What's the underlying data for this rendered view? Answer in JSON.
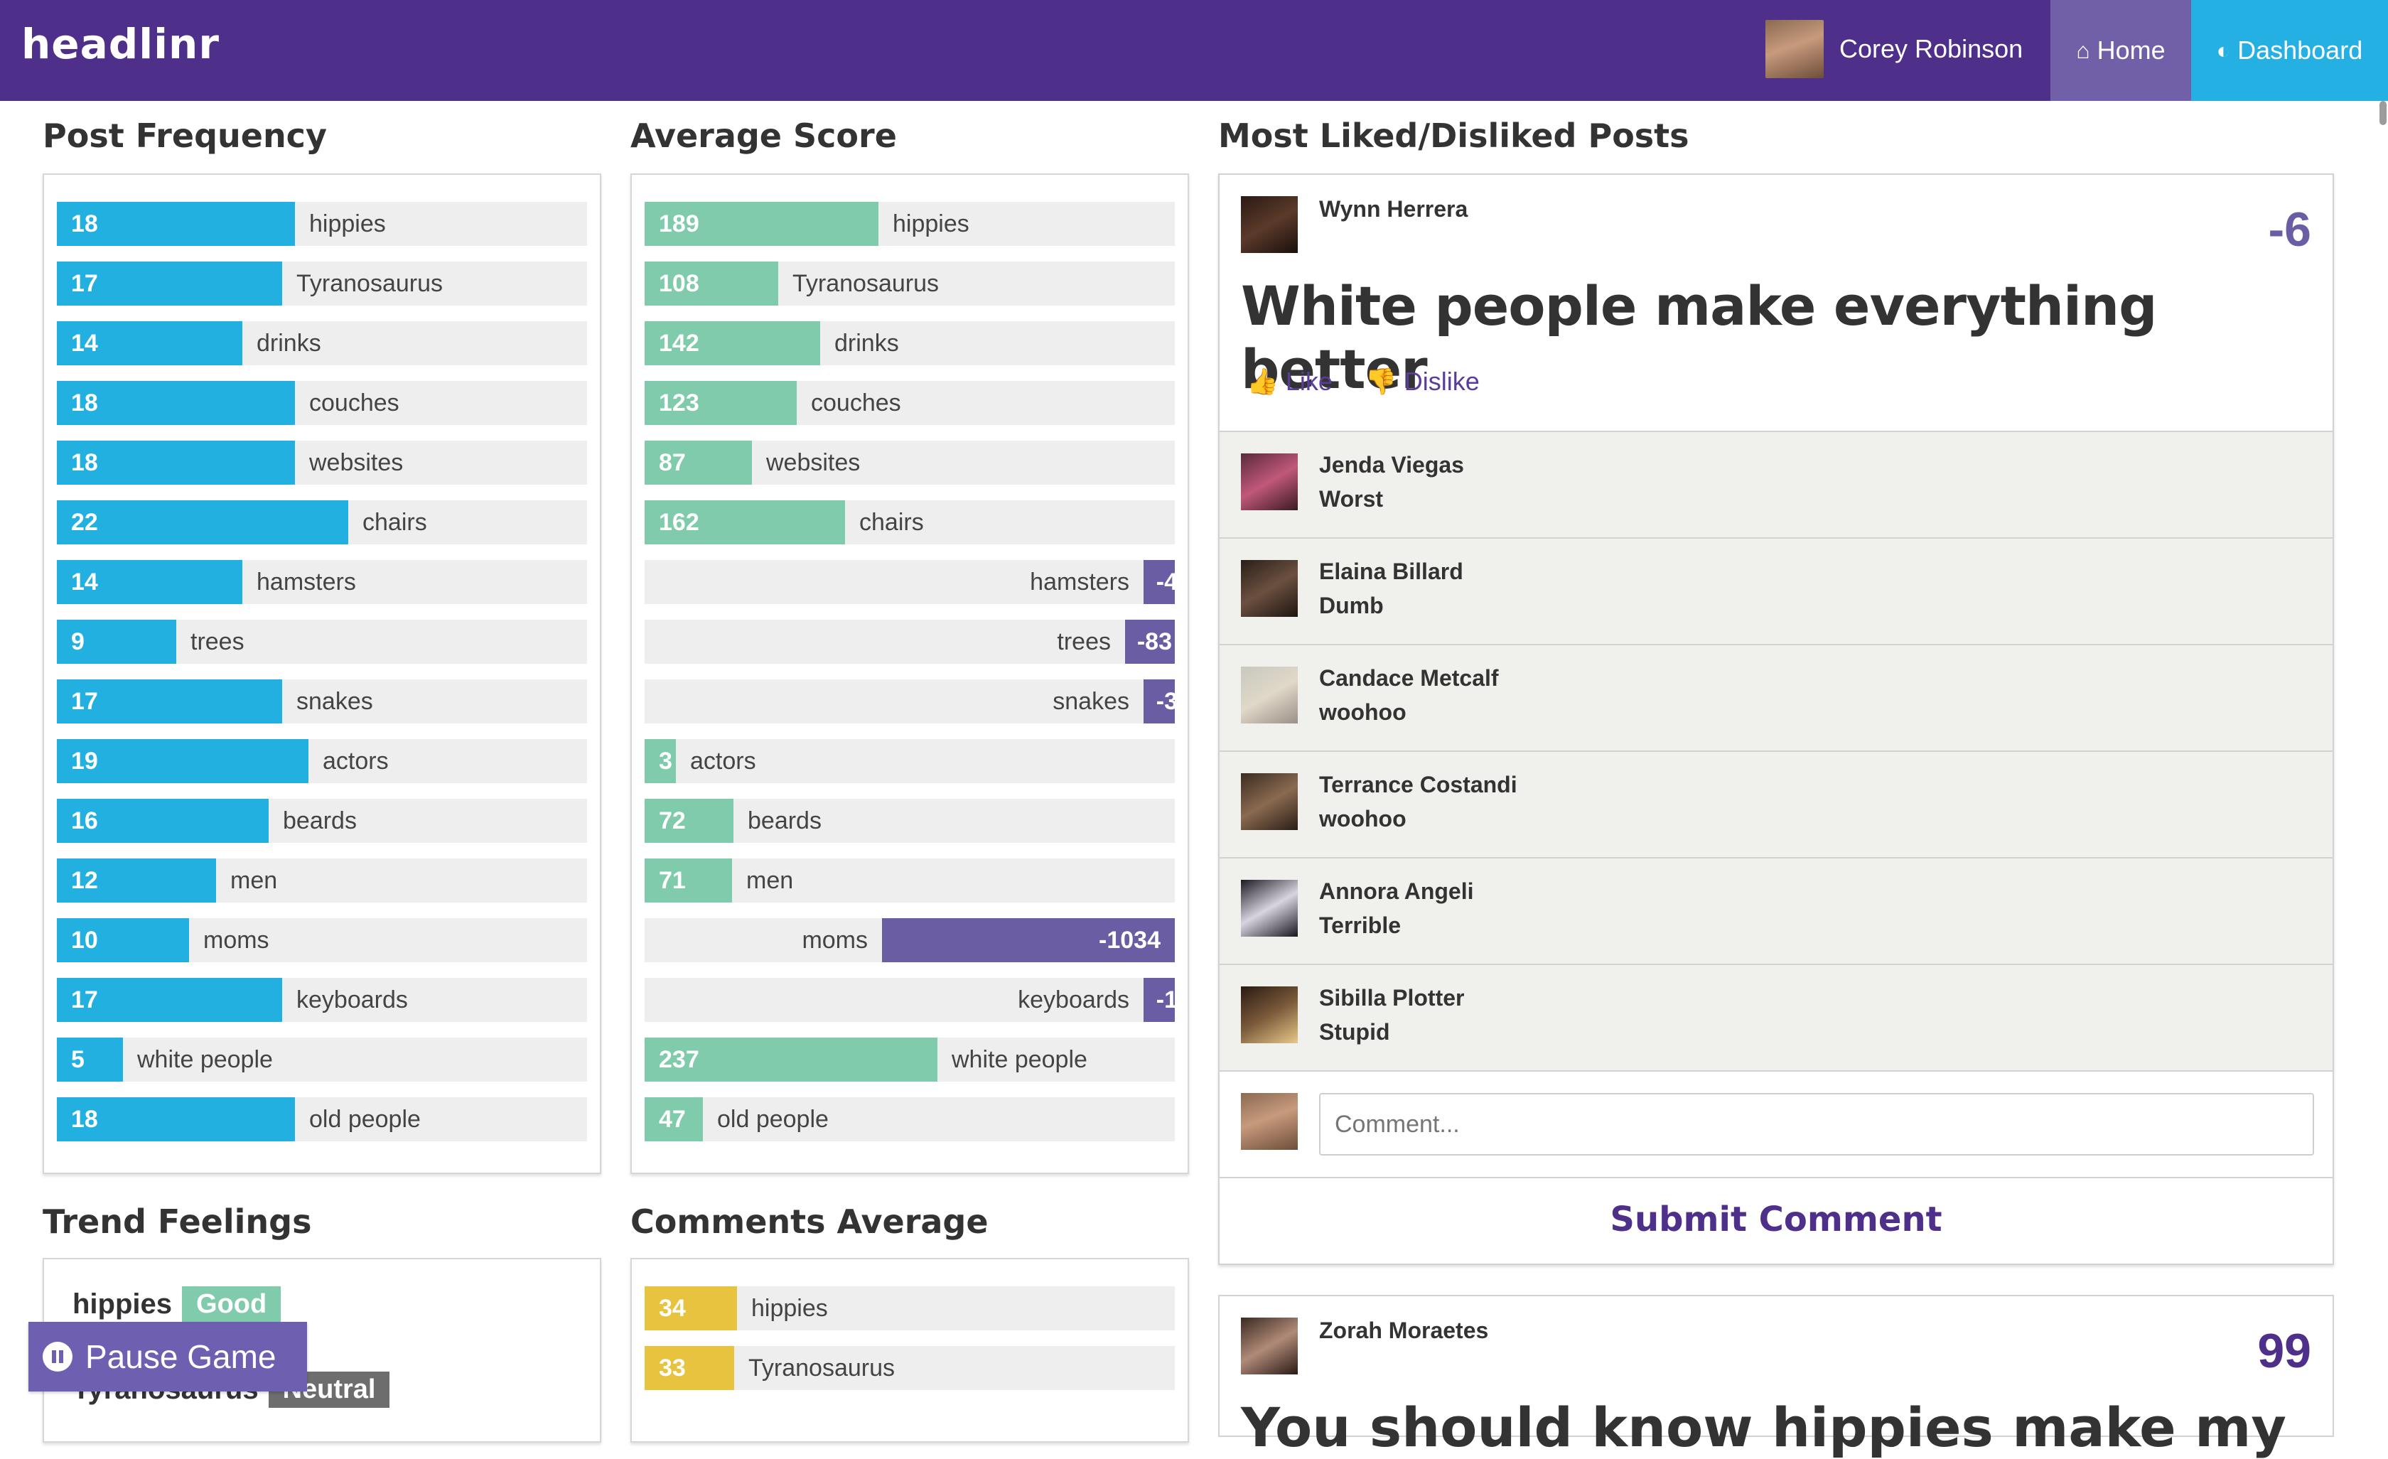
{
  "navbar": {
    "brand": "headlinr",
    "user_name": "Corey Robinson",
    "home_label": "Home",
    "dashboard_label": "Dashboard"
  },
  "sections": {
    "post_frequency": "Post Frequency",
    "average_score": "Average Score",
    "most_liked": "Most Liked/Disliked Posts",
    "trend_feelings": "Trend Feelings",
    "comments_average": "Comments Average"
  },
  "post_frequency": [
    {
      "label": "hippies",
      "value": 18
    },
    {
      "label": "Tyranosaurus",
      "value": 17
    },
    {
      "label": "drinks",
      "value": 14
    },
    {
      "label": "couches",
      "value": 18
    },
    {
      "label": "websites",
      "value": 18
    },
    {
      "label": "chairs",
      "value": 22
    },
    {
      "label": "hamsters",
      "value": 14
    },
    {
      "label": "trees",
      "value": 9
    },
    {
      "label": "snakes",
      "value": 17
    },
    {
      "label": "actors",
      "value": 19
    },
    {
      "label": "beards",
      "value": 16
    },
    {
      "label": "men",
      "value": 12
    },
    {
      "label": "moms",
      "value": 10
    },
    {
      "label": "keyboards",
      "value": 17
    },
    {
      "label": "white people",
      "value": 5
    },
    {
      "label": "old people",
      "value": 18
    }
  ],
  "average_score": [
    {
      "label": "hippies",
      "value": "189"
    },
    {
      "label": "Tyranosaurus",
      "value": "108"
    },
    {
      "label": "drinks",
      "value": "142"
    },
    {
      "label": "couches",
      "value": "123"
    },
    {
      "label": "websites",
      "value": "87"
    },
    {
      "label": "chairs",
      "value": "162"
    },
    {
      "label": "hamsters",
      "value": "-4"
    },
    {
      "label": "trees",
      "value": "-83"
    },
    {
      "label": "snakes",
      "value": "-3"
    },
    {
      "label": "actors",
      "value": "3"
    },
    {
      "label": "beards",
      "value": "72"
    },
    {
      "label": "men",
      "value": "71"
    },
    {
      "label": "moms",
      "value": "-1034"
    },
    {
      "label": "keyboards",
      "value": "-1"
    },
    {
      "label": "white people",
      "value": "237"
    },
    {
      "label": "old people",
      "value": "47"
    }
  ],
  "trend_feelings": [
    {
      "label": "hippies",
      "feeling": "Good",
      "color": "#7fcbac"
    },
    {
      "label": "Tyranosaurus",
      "feeling": "Neutral",
      "color": "#6d6d6d"
    }
  ],
  "comments_average": [
    {
      "label": "hippies",
      "value": 34
    },
    {
      "label": "Tyranosaurus",
      "value": 33
    }
  ],
  "pause_label": "Pause Game",
  "post": {
    "author": "Wynn Herrera",
    "score": "-6",
    "title": "White people make everything better",
    "like_label": "Like",
    "dislike_label": "Dislike",
    "comments": [
      {
        "name": "Jenda Viegas",
        "text": "Worst"
      },
      {
        "name": "Elaina Billard",
        "text": "Dumb"
      },
      {
        "name": "Candace Metcalf",
        "text": "woohoo"
      },
      {
        "name": "Terrance Costandi",
        "text": "woohoo"
      },
      {
        "name": "Annora Angeli",
        "text": "Terrible"
      },
      {
        "name": "Sibilla Plotter",
        "text": "Stupid"
      }
    ],
    "comment_placeholder": "Comment...",
    "submit_label": "Submit Comment"
  },
  "post2": {
    "author": "Zorah Moraetes",
    "score": "99",
    "title": "You should know hippies make my"
  },
  "colors": {
    "nav_bg": "#4e2f8a",
    "frequency_bar": "#22b0e1",
    "score_positive": "#7fcbac",
    "score_negative": "#6a5da4",
    "comments_bar": "#e8c33f"
  }
}
